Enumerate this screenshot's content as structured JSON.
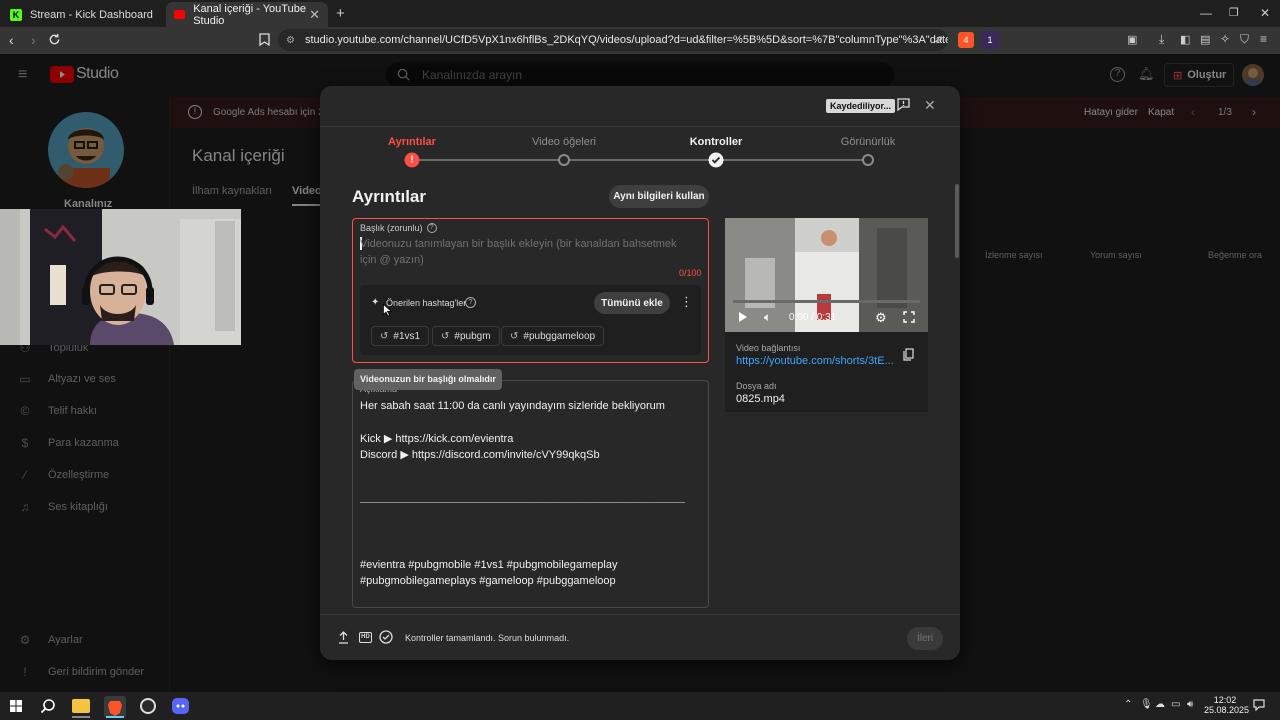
{
  "browser": {
    "tabs": [
      {
        "title": "Stream - Kick Dashboard"
      },
      {
        "title": "Kanal içeriği - YouTube Studio"
      }
    ],
    "url": "studio.youtube.com/channel/UCfD5VpX1nx6hflBs_2DKqYQ/videos/upload?d=ud&filter=%5B%5D&sort=%7B\"columnType\"%3A\"date\"%2C\"sortOrder...",
    "badges": {
      "shield": "4",
      "alert": "1"
    }
  },
  "studio": {
    "logo": "Studio",
    "search_placeholder": "Kanalınızda arayın",
    "create_label": "Oluştur",
    "channel_label": "Kanalınız",
    "page_title": "Kanal içeriği",
    "tabs": [
      "İlham kaynakları",
      "Videol"
    ],
    "banner_text": "Google Ads hesabı için 2 Ad",
    "banner_actions": {
      "fix": "Hatayı gider",
      "close": "Kapat",
      "page": "1/3"
    },
    "columns": [
      "İzlenme sayısı",
      "Yorum sayısı",
      "Beğenme ora"
    ],
    "sidebar": [
      {
        "label": "Topluluk",
        "icon": "community-icon"
      },
      {
        "label": "Altyazı ve ses",
        "icon": "subtitles-icon"
      },
      {
        "label": "Telif hakkı",
        "icon": "copyright-icon"
      },
      {
        "label": "Para kazanma",
        "icon": "dollar-icon"
      },
      {
        "label": "Özelleştirme",
        "icon": "magic-wand-icon"
      },
      {
        "label": "Ses kitaplığı",
        "icon": "audio-library-icon"
      }
    ],
    "sidebar_bottom": [
      {
        "label": "Ayarlar",
        "icon": "gear-icon"
      },
      {
        "label": "Geri bildirim gönder",
        "icon": "feedback-icon"
      }
    ]
  },
  "dialog": {
    "saving": "Kaydediliyor...",
    "steps": [
      {
        "label": "Ayrıntılar",
        "state": "error"
      },
      {
        "label": "Video öğeleri",
        "state": "pending"
      },
      {
        "label": "Kontroller",
        "state": "done"
      },
      {
        "label": "Görünürlük",
        "state": "pending"
      }
    ],
    "section_title": "Ayrıntılar",
    "reuse_button": "Aynı bilgileri kullan",
    "title_field": {
      "label": "Başlık (zorunlu)",
      "placeholder": "Videonuzu tanımlayan bir başlık ekleyin (bir kanaldan bahsetmek için @ yazın)",
      "counter": "0/100"
    },
    "hashtags": {
      "label": "Önerilen hashtag'ler",
      "add_all": "Tümünü ekle",
      "items": [
        "#1vs1",
        "#pubgm",
        "#pubggameloop"
      ]
    },
    "tooltip": "Videonuzun bir başlığı olmalıdır",
    "description_label": "Açıklama",
    "description_lines": [
      "Her sabah saat 11:00 da canlı yayındayım sizleride bekliyorum",
      "",
      "Kick ▶ https://kick.com/evientra",
      "Discord ▶ https://discord.com/invite/cVY99qkqSb",
      "",
      "",
      "______________________________________________________________________________",
      "",
      "",
      "",
      "#evientra #pubgmobile #1vs1 #pubgmobilegameplay",
      "#pubgmobilegameplays #gameloop #pubggameloop"
    ],
    "preview": {
      "time": "0:00 / 0:31",
      "progress": 0,
      "link_label": "Video bağlantısı",
      "link": "https://youtube.com/shorts/3tE...",
      "file_label": "Dosya adı",
      "file": "0825.mp4"
    },
    "footer": {
      "status": "Kontroller tamamlandı. Sorun bulunmadı.",
      "next": "İleri",
      "hd": "HD"
    }
  },
  "taskbar": {
    "time": "12:02",
    "date": "25.08.2025"
  },
  "colors": {
    "error": "#ff4e45",
    "link": "#3ea6ff",
    "accent_red": "#ff0000"
  }
}
